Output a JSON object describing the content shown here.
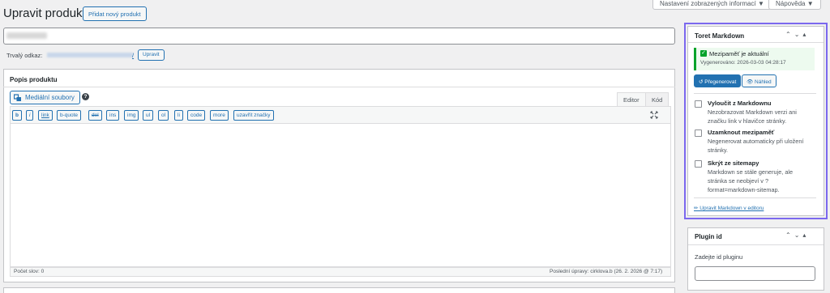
{
  "top_buttons": {
    "screen_options": "Nastavení zobrazených informací ▼",
    "help": "Nápověda ▼"
  },
  "header": {
    "title": "Upravit produkt",
    "add_new": "Přidat nový produkt"
  },
  "permalink": {
    "label": "Trvalý odkaz:",
    "url_suffix": "/",
    "edit_button": "Upravit"
  },
  "description": {
    "title": "Popis produktu",
    "media_button": "Mediální soubory",
    "help": "?",
    "tabs": {
      "visual": "Editor",
      "code": "Kód"
    },
    "quicktags": [
      "b",
      "i",
      "link",
      "b-quote",
      "del",
      "ins",
      "img",
      "ul",
      "ol",
      "li",
      "code",
      "more",
      "uzavřít značky"
    ],
    "word_count": "Počet slov: 0",
    "last_edited": "Poslední úpravy: cirklova.b (26. 2. 2026 @ 7:17)"
  },
  "markdown_panel": {
    "title": "Toret Markdown",
    "notice_title": "Mezipaměť je aktuální",
    "notice_generated": "Vygenerováno: 2026-03-03 04:28:17",
    "regen_button": "↺ Přegenerovat",
    "preview_button": "👁 Náhled",
    "options": [
      {
        "title": "Vyloučit z Markdownu",
        "desc": "Nezobrazovat Markdown verzi ani značku link v hlavičce stránky."
      },
      {
        "title": "Uzamknout mezipaměť",
        "desc": "Negenerovat automaticky při uložení stránky."
      },
      {
        "title": "Skrýt ze sitemapy",
        "desc": "Markdown se stále generuje, ale stránka se neobjeví v ?format=markdown-sitemap."
      }
    ],
    "edit_link": "✏ Upravit Markdown v editoru"
  },
  "plugin_panel": {
    "title": "Plugin id",
    "label": "Zadejte id pluginu",
    "value": ""
  },
  "colors": {
    "accent": "#2271b1",
    "highlight_border": "#7b68ee",
    "success": "#00a32a"
  }
}
